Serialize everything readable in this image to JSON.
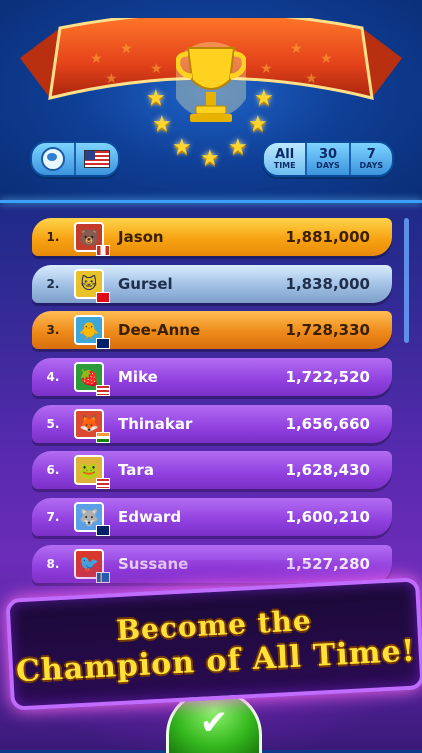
{
  "header": {
    "time_filters": [
      {
        "big": "All",
        "small": "TIME",
        "active": true
      },
      {
        "big": "30",
        "small": "DAYS",
        "active": false
      },
      {
        "big": "7",
        "small": "DAYS",
        "active": false
      }
    ]
  },
  "leaderboard": [
    {
      "rank": "1.",
      "name": "Jason",
      "score": "1,881,000",
      "tier": "gold",
      "avatar": "🐻",
      "avatar_bg": "#c43b2b",
      "flag": "canada"
    },
    {
      "rank": "2.",
      "name": "Gursel",
      "score": "1,838,000",
      "tier": "silver",
      "avatar": "🐱",
      "avatar_bg": "#e9c22a",
      "flag": "turkey"
    },
    {
      "rank": "3.",
      "name": "Dee-Anne",
      "score": "1,728,330",
      "tier": "bronze",
      "avatar": "🐥",
      "avatar_bg": "#3ea7d8",
      "flag": "australia"
    },
    {
      "rank": "4.",
      "name": "Mike",
      "score": "1,722,520",
      "tier": "purple",
      "avatar": "🍓",
      "avatar_bg": "#2e9b3a",
      "flag": "usa"
    },
    {
      "rank": "5.",
      "name": "Thinakar",
      "score": "1,656,660",
      "tier": "purple",
      "avatar": "🦊",
      "avatar_bg": "#d94a30",
      "flag": "india"
    },
    {
      "rank": "6.",
      "name": "Tara",
      "score": "1,628,430",
      "tier": "purple",
      "avatar": "🐸",
      "avatar_bg": "#e0b23a",
      "flag": "usa"
    },
    {
      "rank": "7.",
      "name": "Edward",
      "score": "1,600,210",
      "tier": "purple",
      "avatar": "🐺",
      "avatar_bg": "#5aa0e6",
      "flag": "uk"
    },
    {
      "rank": "8.",
      "name": "Sussane",
      "score": "1,527,280",
      "tier": "purple",
      "avatar": "🐦",
      "avatar_bg": "#d8392c",
      "flag": "sweden"
    }
  ],
  "banner": {
    "line1": "Become the",
    "line2": "Champion of All Time!"
  },
  "colors": {
    "gold_row": "#f7a313",
    "silver_row": "#9fbfe4",
    "bronze_row": "#ee8a1a",
    "purple_row": "#9040df",
    "banner_text": "#ffe13a"
  }
}
